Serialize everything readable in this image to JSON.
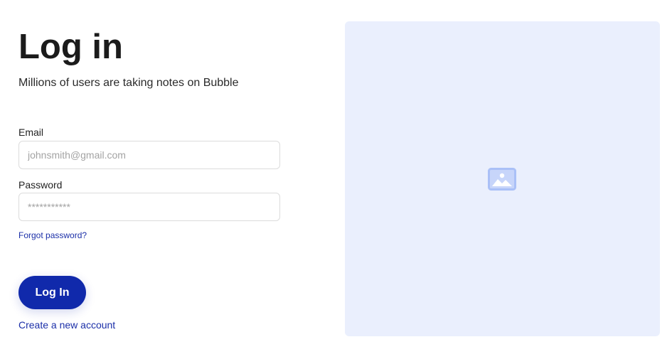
{
  "page": {
    "title": "Log in",
    "subtitle": "Millions of users are taking notes on Bubble"
  },
  "form": {
    "email_label": "Email",
    "email_placeholder": "johnsmith@gmail.com",
    "email_value": "",
    "password_label": "Password",
    "password_placeholder": "***********",
    "password_value": "",
    "forgot_link": "Forgot password?",
    "submit_label": "Log In",
    "create_account_link": "Create a new account"
  },
  "illustration": {
    "icon": "image-icon"
  },
  "colors": {
    "accent": "#1029ab",
    "link": "#1b2fa8",
    "panel_bg": "#eaeffd",
    "icon": "#aac0f7"
  }
}
